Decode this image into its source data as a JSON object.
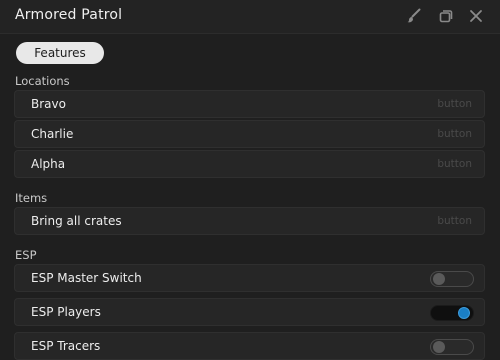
{
  "window": {
    "title": "Armored Patrol",
    "icons": [
      "brush-icon",
      "restore-window-icon",
      "close-icon"
    ]
  },
  "tabs": {
    "active_label": "Features"
  },
  "sections": {
    "locations": {
      "label": "Locations",
      "items": [
        {
          "label": "Bravo",
          "hint": "button"
        },
        {
          "label": "Charlie",
          "hint": "button"
        },
        {
          "label": "Alpha",
          "hint": "button"
        }
      ]
    },
    "items": {
      "label": "Items",
      "items": [
        {
          "label": "Bring all crates",
          "hint": "button"
        }
      ]
    },
    "esp": {
      "label": "ESP",
      "items": [
        {
          "label": "ESP Master Switch",
          "state": "off"
        },
        {
          "label": "ESP Players",
          "state": "on"
        },
        {
          "label": "ESP Tracers",
          "state": "off"
        }
      ]
    }
  },
  "colors": {
    "background": "#1f1f1f",
    "row": "#262626",
    "accent": "#1a7fc6"
  }
}
